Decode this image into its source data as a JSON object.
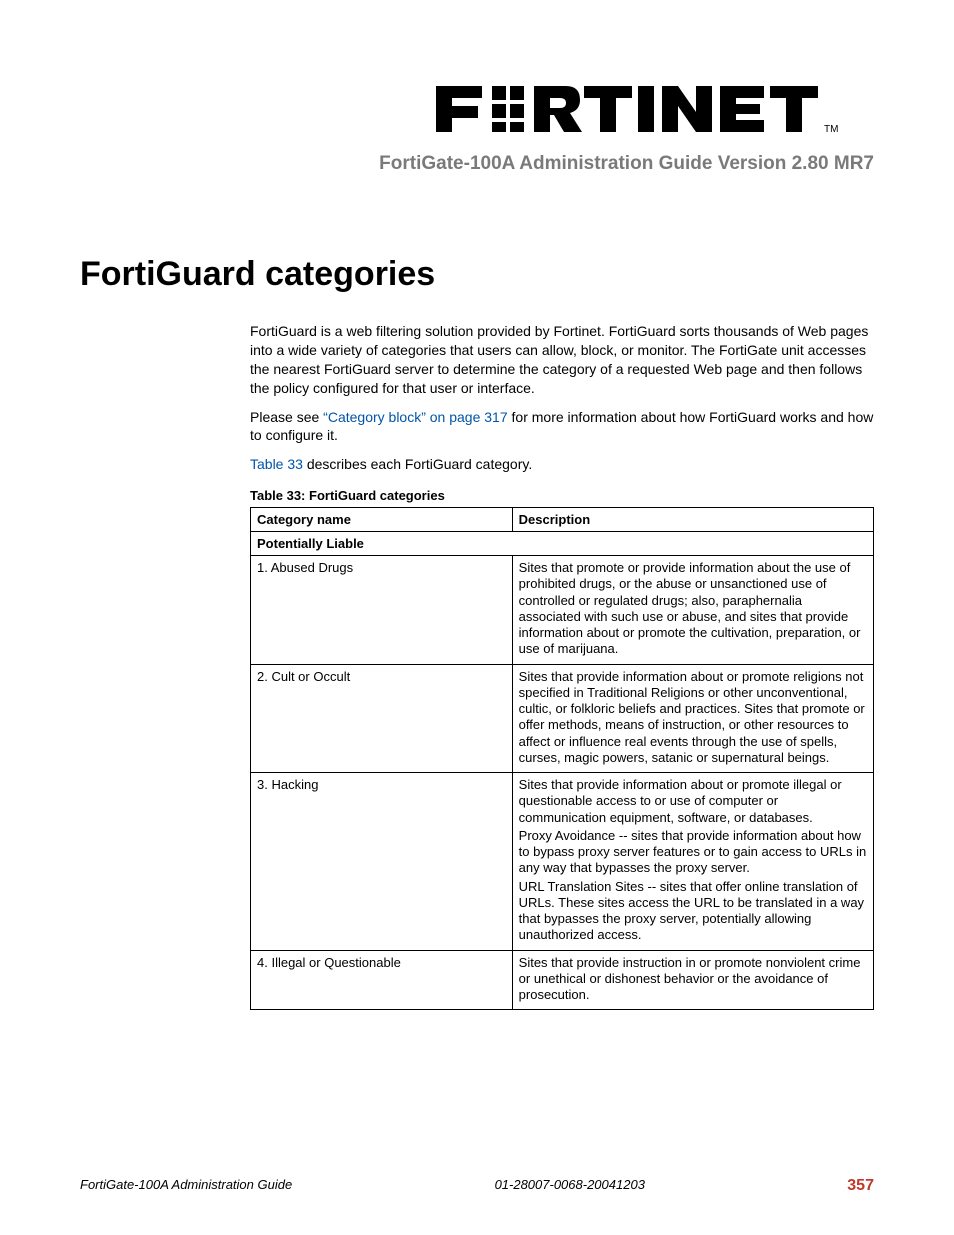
{
  "header": {
    "doc_title": "FortiGate-100A Administration Guide Version 2.80 MR7"
  },
  "section": {
    "title": "FortiGuard categories",
    "intro_para": "FortiGuard is a web filtering solution provided by Fortinet. FortiGuard sorts thousands of Web pages into a wide variety of categories that users can allow, block, or monitor. The FortiGate unit accesses the nearest FortiGuard server to determine the category of a requested Web page and then follows the policy configured for that user or interface.",
    "see_prefix": "Please see ",
    "see_link": "“Category block” on page 317",
    "see_suffix": " for more information about how FortiGuard works and how to configure it.",
    "table_ref_link": "Table 33",
    "table_ref_suffix": " describes each FortiGuard category."
  },
  "table": {
    "caption": "Table 33: FortiGuard categories",
    "head_name": "Category name",
    "head_desc": "Description",
    "section_label": "Potentially Liable",
    "rows": [
      {
        "name": "1. Abused Drugs",
        "desc": [
          "Sites that promote or provide information about the use of prohibited drugs, or the abuse or unsanctioned use of controlled or regulated drugs; also, paraphernalia associated with such use or abuse, and sites that provide information about or promote the cultivation, preparation, or use of marijuana."
        ]
      },
      {
        "name": "2. Cult or Occult",
        "desc": [
          "Sites that provide information about or promote religions not specified in Traditional Religions or other unconventional, cultic, or folkloric beliefs and practices. Sites that promote or offer methods, means of instruction, or other resources to affect or influence real events through the use of spells, curses, magic powers, satanic or supernatural beings."
        ]
      },
      {
        "name": "3. Hacking",
        "desc": [
          "Sites that provide information about or promote illegal or questionable access to or use of computer or communication equipment, software, or databases.",
          "Proxy Avoidance -- sites that provide information about how to bypass proxy server features or to gain access to URLs in any way that bypasses the proxy server.",
          "URL Translation Sites -- sites that offer online translation of URLs. These sites access the URL to be translated in a way that bypasses the proxy server, potentially allowing unauthorized access."
        ]
      },
      {
        "name": "4. Illegal or Questionable",
        "desc": [
          "Sites that provide instruction in or promote nonviolent crime or unethical or dishonest behavior or the avoidance of prosecution."
        ]
      }
    ]
  },
  "footer": {
    "left": "FortiGate-100A Administration Guide",
    "center": "01-28007-0068-20041203",
    "page": "357"
  }
}
